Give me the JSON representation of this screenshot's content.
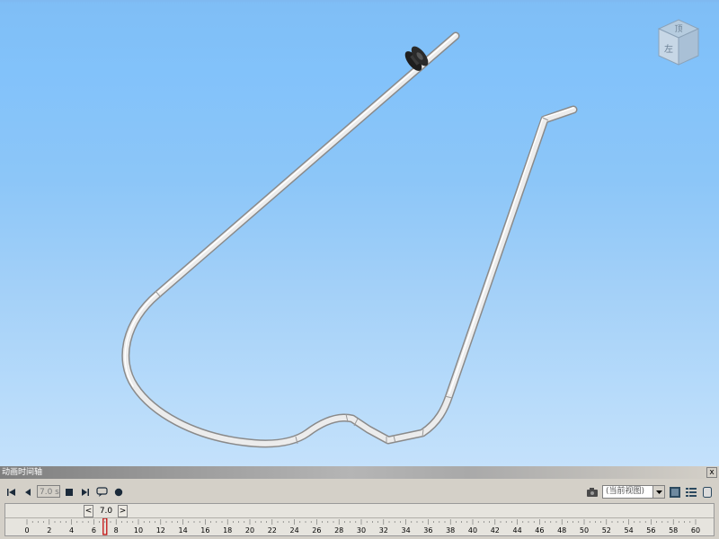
{
  "window": {
    "viewport_gradient": [
      "#7fbef6",
      "#c4e1fb"
    ]
  },
  "viewcube": {
    "icon": "viewcube-icon",
    "top_face": "顶",
    "front_face": "左"
  },
  "model": {
    "color": "#e8e8e8",
    "knob_color": "#222222"
  },
  "timeline": {
    "title": "动画时间轴",
    "close_label": "x",
    "controls": {
      "to_start": "skip-to-start-icon",
      "play_reverse": "play-reverse-icon",
      "time_value": "7.0 s",
      "stop": "stop-icon",
      "play_forward": "play-forward-icon",
      "minimize": "minimize-player-icon",
      "record": "record-icon"
    },
    "right_tools": {
      "camera": "camera-icon",
      "view_option": "(当前视图)",
      "settings": "timeline-settings-icon",
      "list": "animation-list-icon",
      "expand": "expand-panel-icon"
    },
    "scrubber": {
      "prev": "<",
      "next": ">",
      "value": "7.0",
      "current_time": 7.0,
      "max": 60,
      "ticks": [
        "0",
        "2",
        "4",
        "6",
        "8",
        "10",
        "12",
        "14",
        "16",
        "18",
        "20",
        "22",
        "24",
        "26",
        "28",
        "30",
        "32",
        "34",
        "36",
        "38",
        "40",
        "42",
        "44",
        "46",
        "48",
        "50",
        "52",
        "54",
        "56",
        "58",
        "60"
      ]
    }
  }
}
